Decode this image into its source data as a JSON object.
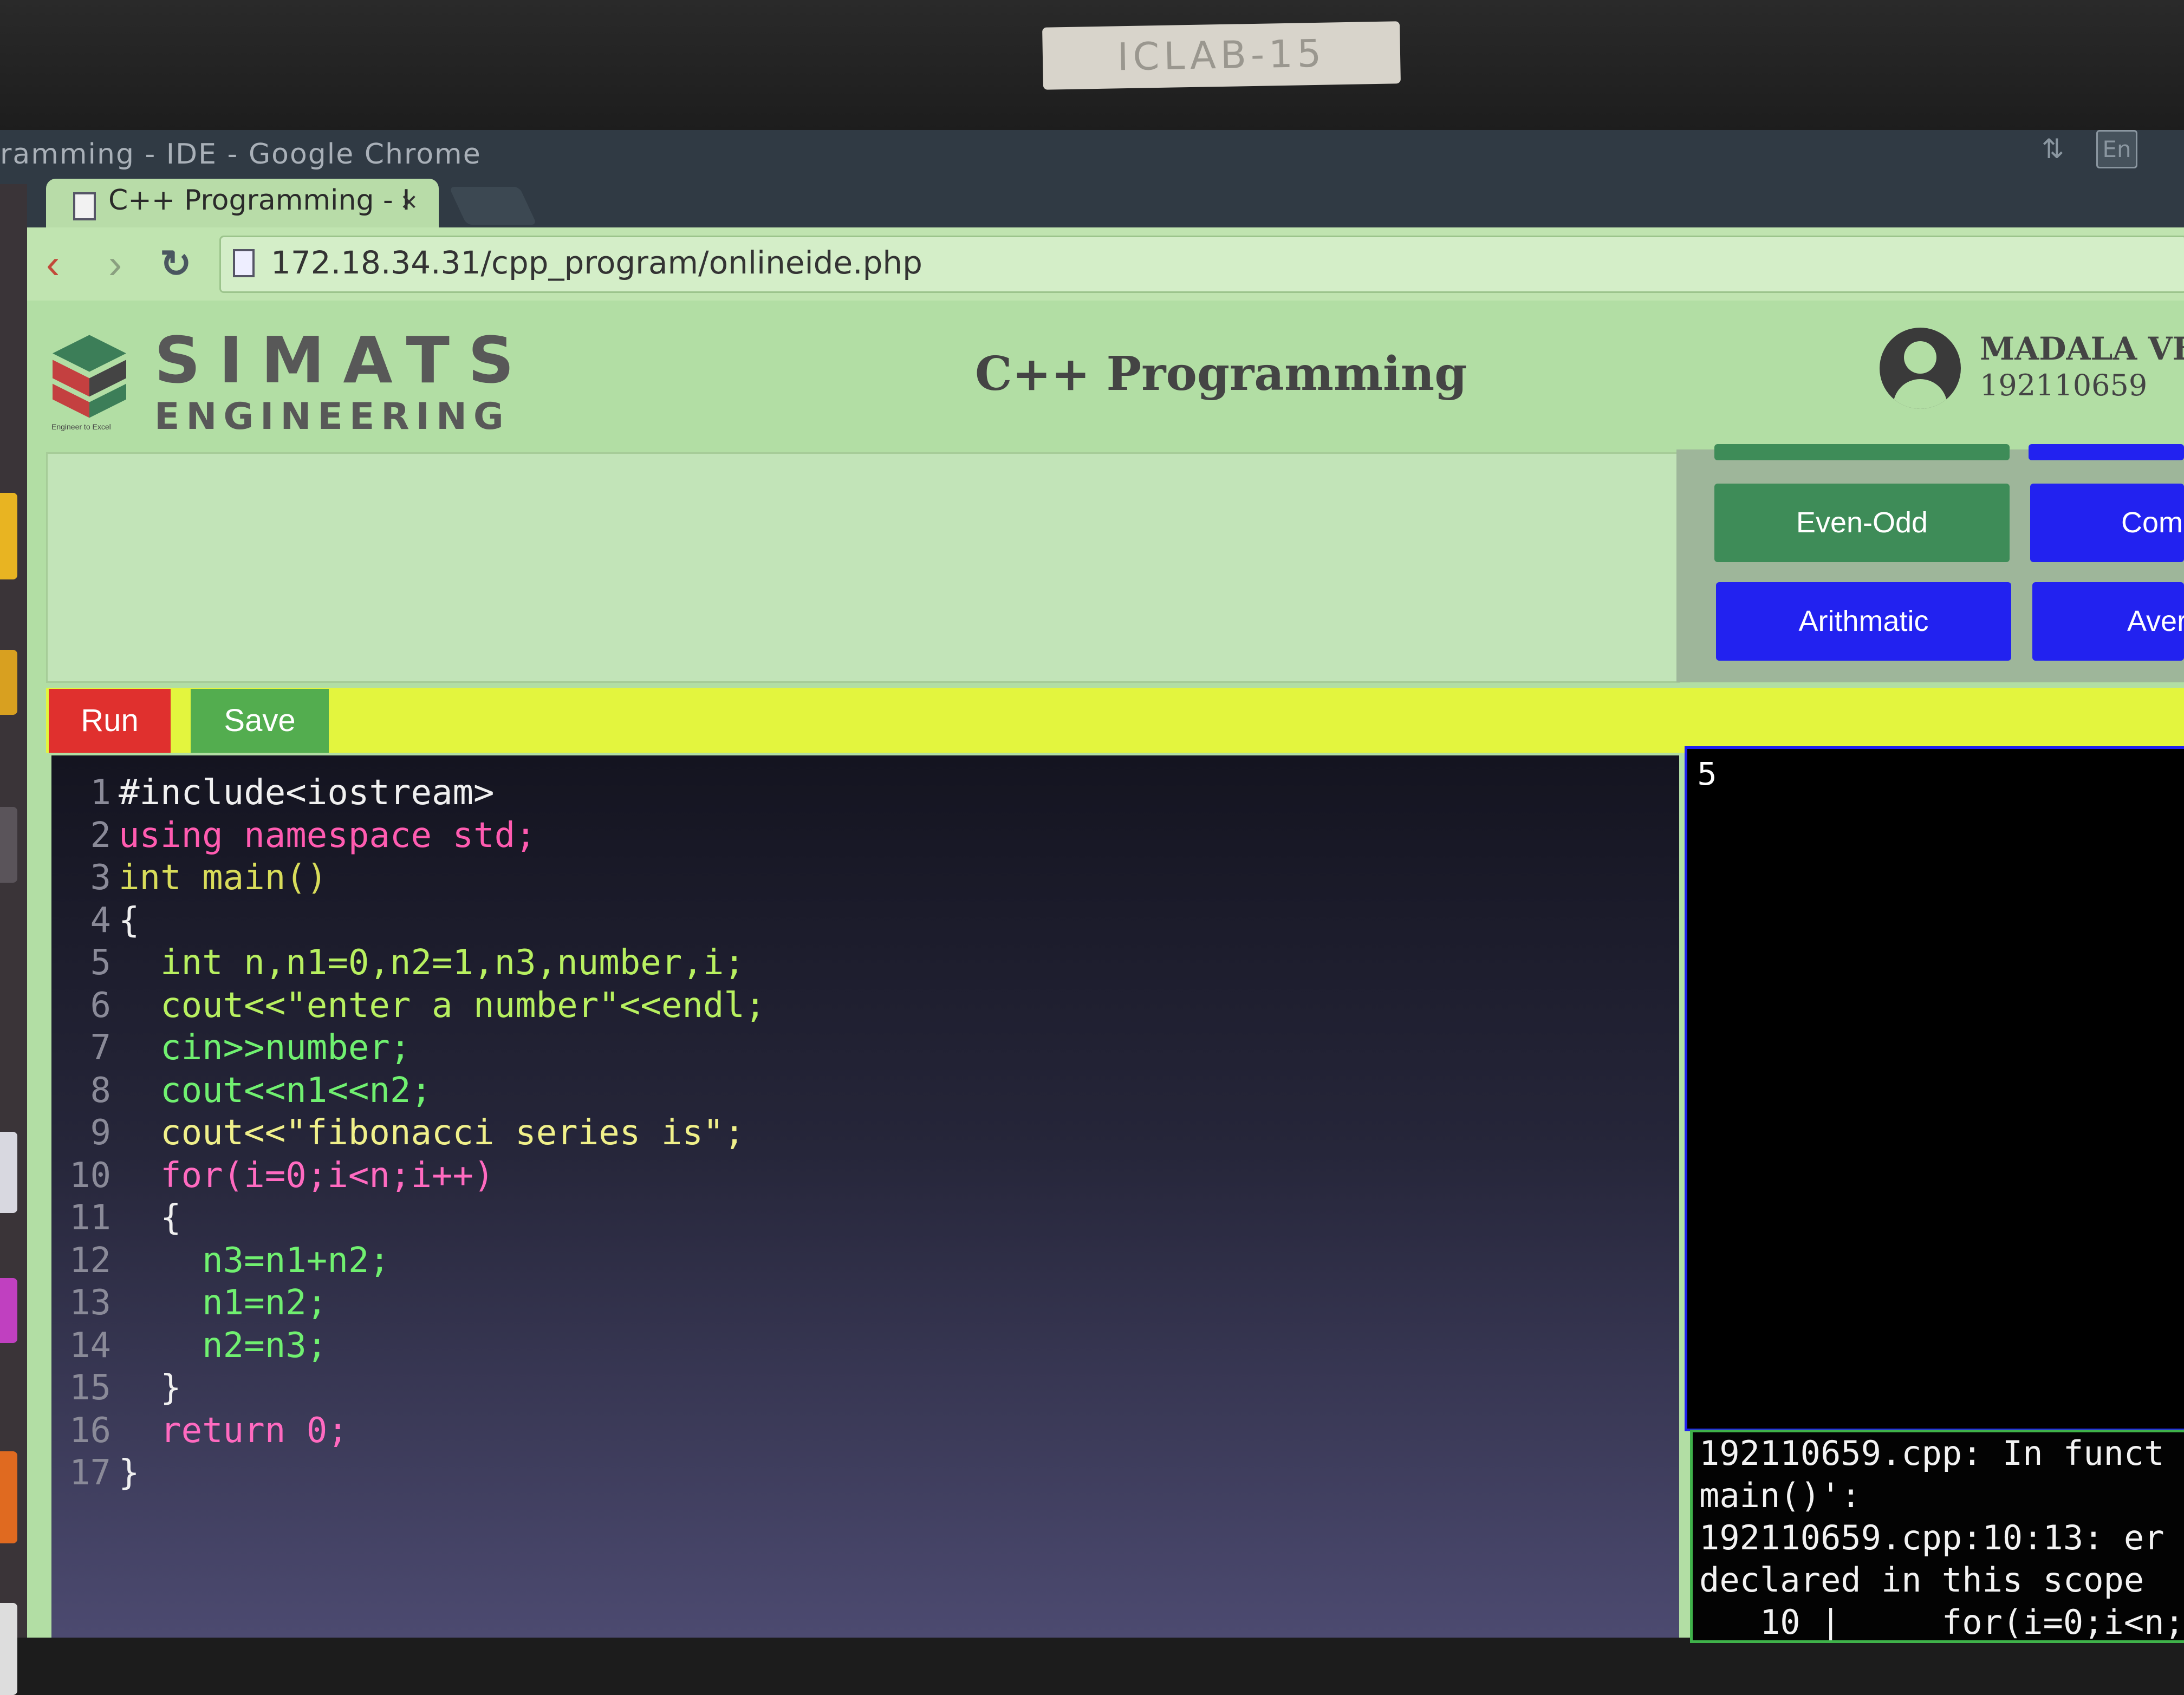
{
  "sticker_text": "ICLAB-15",
  "window": {
    "title": "ramming - IDE - Google Chrome",
    "lang_indicator": "En"
  },
  "tab": {
    "title": "C++ Programming - I",
    "close": "×"
  },
  "address_bar": {
    "url": "172.18.34.31/cpp_program/onlineide.php"
  },
  "header": {
    "brand_top": "SIMATS",
    "brand_bottom": "ENGINEERING",
    "brand_tagline": "Engineer to Excel",
    "title": "C++ Programming",
    "user_name": "MADALA VEN",
    "user_id": "192110659"
  },
  "program_buttons": [
    {
      "label": "Even-Odd",
      "color": "#3e8c58"
    },
    {
      "label": "Comp",
      "color": "#2222f0"
    },
    {
      "label": "Arithmatic",
      "color": "#2222f0"
    },
    {
      "label": "Aver",
      "color": "#2222f0"
    }
  ],
  "actions": {
    "run": "Run",
    "save": "Save"
  },
  "code_lines": [
    {
      "n": "1",
      "text": "#include<iostream>",
      "color": "#f0f0f0"
    },
    {
      "n": "2",
      "text": "using namespace std;",
      "color": "#ff5bb0"
    },
    {
      "n": "3",
      "text": "int main()",
      "color": "#d8dc5a"
    },
    {
      "n": "4",
      "text": "{",
      "color": "#f0f0f0"
    },
    {
      "n": "5",
      "text": "  int n,n1=0,n2=1,n3,number,i;",
      "color": "#b8f060"
    },
    {
      "n": "6",
      "text": "  cout<<\"enter a number\"<<endl;",
      "color": "#b8f060"
    },
    {
      "n": "7",
      "text": "  cin>>number;",
      "color": "#70f070"
    },
    {
      "n": "8",
      "text": "  cout<<n1<<n2;",
      "color": "#70f070"
    },
    {
      "n": "9",
      "text": "  cout<<\"fibonacci series is\";",
      "color": "#f0f08a"
    },
    {
      "n": "10",
      "text": "  for(i=0;i<n;i++)",
      "color": "#ff6ac0"
    },
    {
      "n": "11",
      "text": "  {",
      "color": "#f0f0f0"
    },
    {
      "n": "12",
      "text": "    n3=n1+n2;",
      "color": "#70f070"
    },
    {
      "n": "13",
      "text": "    n1=n2;",
      "color": "#70f070"
    },
    {
      "n": "14",
      "text": "    n2=n3;",
      "color": "#70f070"
    },
    {
      "n": "15",
      "text": "  }",
      "color": "#f0f0f0"
    },
    {
      "n": "16",
      "text": "  return 0;",
      "color": "#ff6ac0"
    },
    {
      "n": "17",
      "text": "}",
      "color": "#f0f0f0"
    }
  ],
  "input_panel": {
    "value": "5"
  },
  "error_panel": {
    "lines": [
      "192110659.cpp: In funct",
      "main()':",
      "192110659.cpp:10:13: er",
      "declared in this scope",
      "   10 |     for(i=0;i<n;"
    ]
  }
}
